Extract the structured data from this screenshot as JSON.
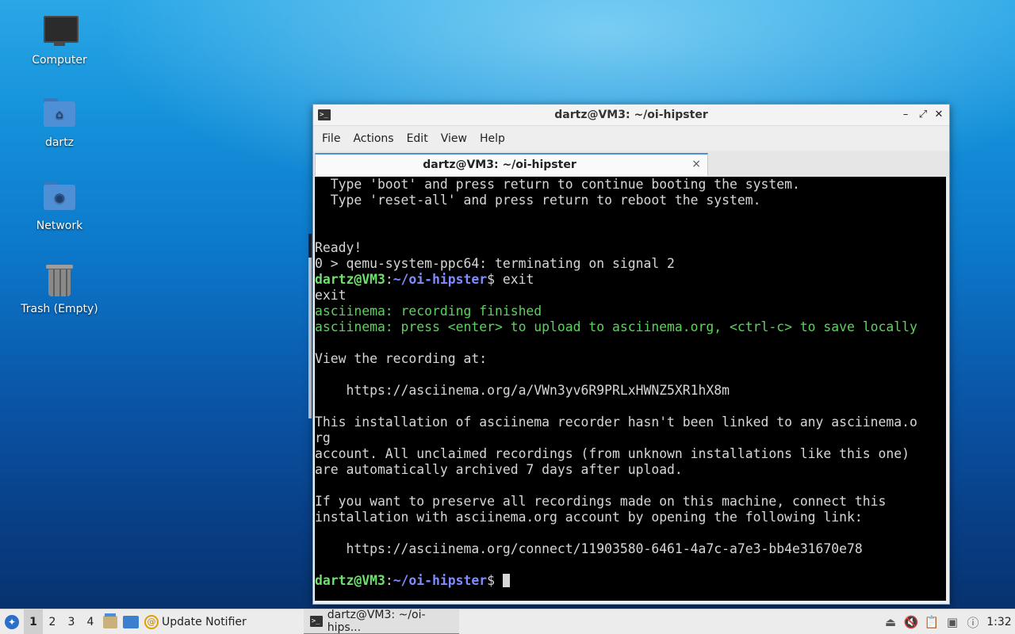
{
  "desktop": {
    "icons": [
      {
        "label": "Computer",
        "icon": "computer-icon"
      },
      {
        "label": "dartz",
        "icon": "home-folder-icon"
      },
      {
        "label": "Network",
        "icon": "network-folder-icon"
      },
      {
        "label": "Trash (Empty)",
        "icon": "trash-icon"
      }
    ]
  },
  "window": {
    "title": "dartz@VM3: ~/oi-hipster",
    "menu": [
      "File",
      "Actions",
      "Edit",
      "View",
      "Help"
    ],
    "tab_label": "dartz@VM3: ~/oi-hipster",
    "tab_close": "×",
    "controls": {
      "minimize": "–",
      "maximize": "⤢",
      "close": "✕"
    }
  },
  "terminal": {
    "prompt_user": "dartz@VM3",
    "prompt_path": "~/oi-hipster",
    "lines": [
      "  Type 'boot' and press return to continue booting the system.",
      "  Type 'reset-all' and press return to reboot the system.",
      "",
      "",
      "Ready!",
      "0 > qemu-system-ppc64: terminating on signal 2",
      "$ exit",
      "exit",
      "asciinema: recording finished",
      "asciinema: press <enter> to upload to asciinema.org, <ctrl-c> to save locally",
      "",
      "View the recording at:",
      "",
      "    https://asciinema.org/a/VWn3yv6R9PRLxHWNZ5XR1hX8m",
      "",
      "This installation of asciinema recorder hasn't been linked to any asciinema.o",
      "rg",
      "account. All unclaimed recordings (from unknown installations like this one)",
      "are automatically archived 7 days after upload.",
      "",
      "If you want to preserve all recordings made on this machine, connect this",
      "installation with asciinema.org account by opening the following link:",
      "",
      "    https://asciinema.org/connect/11903580-6461-4a7c-a7e3-bb4e31670e78",
      "",
      "$ "
    ]
  },
  "taskbar": {
    "desktops": [
      "1",
      "2",
      "3",
      "4"
    ],
    "active_desktop": "1",
    "update_notifier": "Update Notifier",
    "terminal_task": "dartz@VM3: ~/oi-hips...",
    "clock": "1:32"
  }
}
